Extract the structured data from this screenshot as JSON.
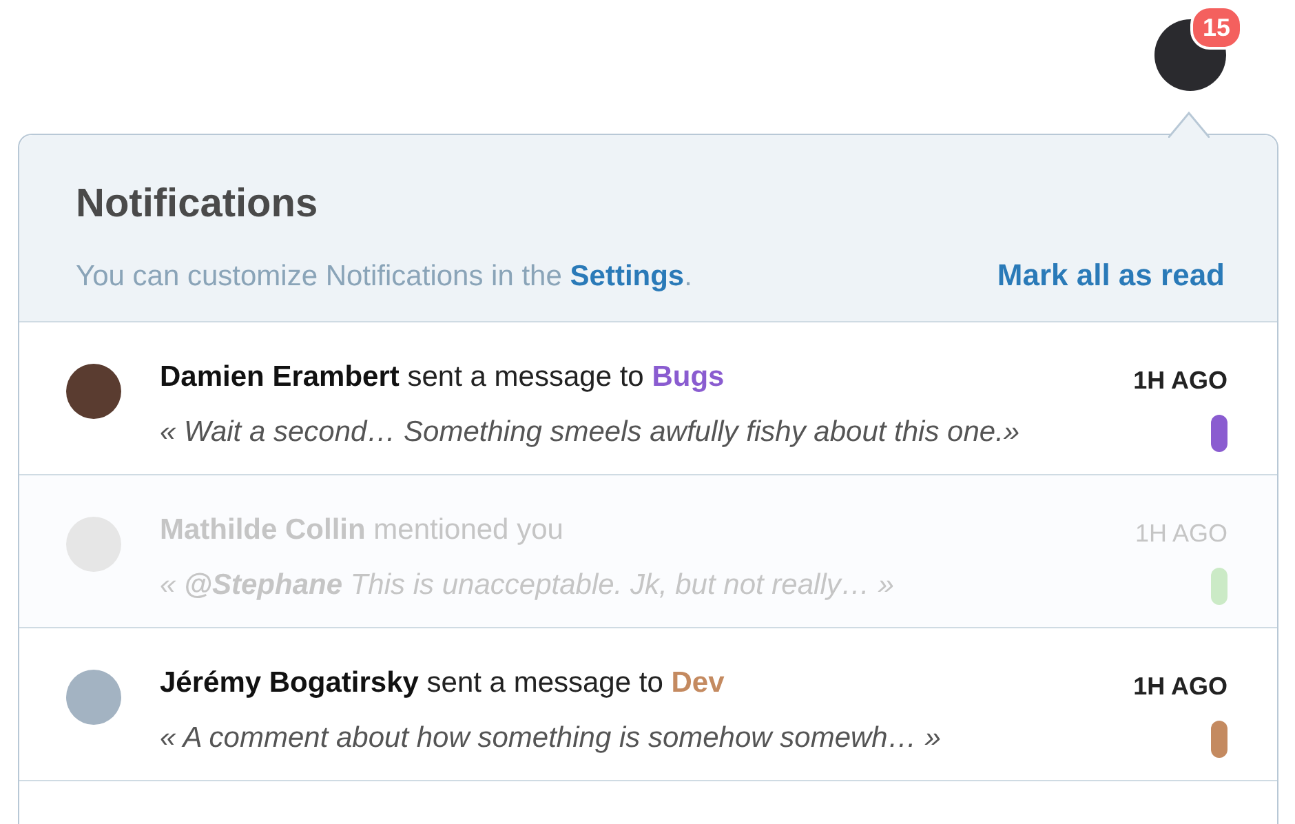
{
  "user": {
    "badge": "15"
  },
  "panel": {
    "title": "Notifications",
    "subtitle_before": "You can customize Notifications in the",
    "settings_link": "Settings",
    "subtitle_after": ".",
    "mark_all": "Mark all as read"
  },
  "notifications": [
    {
      "author": "Damien Erambert",
      "action": "sent a message to",
      "channel": "Bugs",
      "quote": "« Wait a second… Something smeels awfully fishy about this one.»",
      "time": "1H AGO",
      "read": false,
      "color": "#8a5cd0"
    },
    {
      "author": "Mathilde Collin",
      "action": "mentioned you",
      "quote": "« **@Stephane** This is unacceptable. Jk, but not really… »",
      "time": "1H AGO",
      "read": true,
      "color": "#cbeac6"
    },
    {
      "author": "Jérémy Bogatirsky",
      "action": "sent a message to",
      "channel": "Dev",
      "quote": "« A comment about how something is somehow somewh… »",
      "time": "1H AGO",
      "read": false,
      "color": "#c48a60"
    }
  ]
}
